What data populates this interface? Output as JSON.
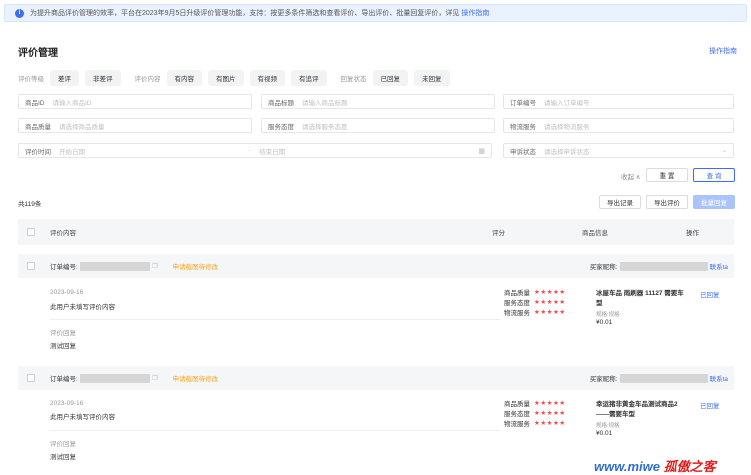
{
  "notice": {
    "text": "为提升商品评价管理的效率，平台在2023年9月5日升级评价管理功能，支持：按更多条件筛选和查看评价、导出评价、批量回复评价，详见",
    "link": "操作指南"
  },
  "page": {
    "title": "评价管理",
    "guide_link": "操作指南"
  },
  "filters": {
    "level_label": "评价等级",
    "level_options": [
      "差评",
      "非差评"
    ],
    "content_label": "评价内容",
    "content_options": [
      "有内容",
      "有图片",
      "有视频",
      "有追评"
    ],
    "reply_label": "回复状态",
    "reply_options": [
      "已回复",
      "未回复"
    ]
  },
  "form": {
    "product_id": {
      "label": "商品ID",
      "placeholder": "请输入商品ID"
    },
    "product_title": {
      "label": "商品标题",
      "placeholder": "请输入商品标题"
    },
    "order_no": {
      "label": "订单编号",
      "placeholder": "请输入订单编号"
    },
    "product_quality": {
      "label": "商品质量",
      "placeholder": "请选择商品质量"
    },
    "service_attitude": {
      "label": "服务态度",
      "placeholder": "请选择服务态度"
    },
    "logistics_service": {
      "label": "物流服务",
      "placeholder": "请选择物流服务"
    },
    "review_time": {
      "label": "评价时间",
      "start": "开始日期",
      "sep": "-",
      "end": "结束日期"
    },
    "appeal_status": {
      "label": "申诉状态",
      "placeholder": "请选择申诉状态"
    }
  },
  "actions": {
    "collapse": "收起 ∧",
    "reset": "重 置",
    "query": "查 询"
  },
  "list": {
    "total": "共119条",
    "export_records": "导出记录",
    "export_reviews": "导出评价",
    "batch_reply": "批量回复"
  },
  "table_headers": {
    "content": "评价内容",
    "score": "评分",
    "product": "商品信息",
    "ops": "操作"
  },
  "reviews": [
    {
      "order_label": "订单编号:",
      "tag": "申请截图待修改",
      "buyer_label": "买家昵称:",
      "contact": "联系ta",
      "date": "2023-09-16",
      "content": "此用户未填写评价内容",
      "reply_label": "评价回复",
      "reply_text": "测试回复",
      "scores": [
        {
          "name": "商品质量",
          "stars": "★★★★★"
        },
        {
          "name": "服务态度",
          "stars": "★★★★★"
        },
        {
          "name": "物流服务",
          "stars": "★★★★★"
        }
      ],
      "product_title": "冰屋车品 雨刷器 11127 需要车型",
      "spec": "规格:规格",
      "price": "¥0.01",
      "status": "已回复"
    },
    {
      "order_label": "订单编号:",
      "tag": "申请截图待修改",
      "buyer_label": "买家昵称:",
      "contact": "联系ta",
      "date": "2023-09-16",
      "content": "此用户未填写评价内容",
      "reply_label": "评价回复",
      "reply_text": "测试回复",
      "scores": [
        {
          "name": "商品质量",
          "stars": "★★★★★"
        },
        {
          "name": "服务态度",
          "stars": "★★★★★"
        },
        {
          "name": "物流服务",
          "stars": "★★★★★"
        }
      ],
      "product_title": "幸运猪非黄金车品测试商品2——需要车型",
      "spec": "规格:规格",
      "price": "¥0.01",
      "status": "已回复"
    }
  ],
  "watermark": {
    "part1": "孤傲之客",
    "part2": "www.miwe"
  }
}
